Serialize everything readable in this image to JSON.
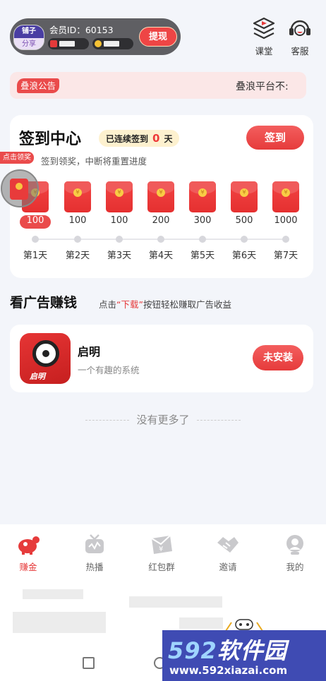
{
  "header": {
    "avatar_top": "铺子",
    "avatar_bottom": "分享",
    "member_id_label": "会员ID：",
    "member_id": "60153",
    "withdraw_label": "提现",
    "course_label": "课堂",
    "service_label": "客服"
  },
  "notice": {
    "tag": "叠浪公告",
    "text": "叠浪平台不:"
  },
  "signin": {
    "title": "签到中心",
    "streak_prefix": "已连续签到",
    "streak_days": "0",
    "streak_suffix": "天",
    "button": "签到",
    "subtitle": "签到领奖，中断将重置进度",
    "claim_tag": "点击领奖",
    "days": [
      {
        "amount": "100",
        "label": "第1天"
      },
      {
        "amount": "100",
        "label": "第2天"
      },
      {
        "amount": "100",
        "label": "第3天"
      },
      {
        "amount": "200",
        "label": "第4天"
      },
      {
        "amount": "300",
        "label": "第5天"
      },
      {
        "amount": "500",
        "label": "第6天"
      },
      {
        "amount": "1000",
        "label": "第7天"
      }
    ]
  },
  "ads": {
    "title": "看广告赚钱",
    "hint_before": "点击",
    "hint_highlight": "“下载”",
    "hint_after": "按钮轻松赚取广告收益",
    "app": {
      "name": "启明",
      "description": "一个有趣的系统",
      "icon_text": "启明",
      "install_label": "未安装"
    },
    "no_more": "没有更多了"
  },
  "nav": [
    {
      "label": "赚金",
      "icon": "piggy-bank-icon",
      "active": true
    },
    {
      "label": "热播",
      "icon": "tv-icon",
      "active": false
    },
    {
      "label": "红包群",
      "icon": "red-packet-group-icon",
      "active": false
    },
    {
      "label": "邀请",
      "icon": "handshake-icon",
      "active": false
    },
    {
      "label": "我的",
      "icon": "profile-icon",
      "active": false
    }
  ],
  "more_dots": "···",
  "watermark": {
    "digits": "592",
    "text": "软件园",
    "url": "www.592xiazai.com"
  },
  "colors": {
    "accent": "#e63b3b",
    "background": "#f3f5fa",
    "member_card": "#5f5f63",
    "watermark_bg": "#3f4bb3"
  }
}
